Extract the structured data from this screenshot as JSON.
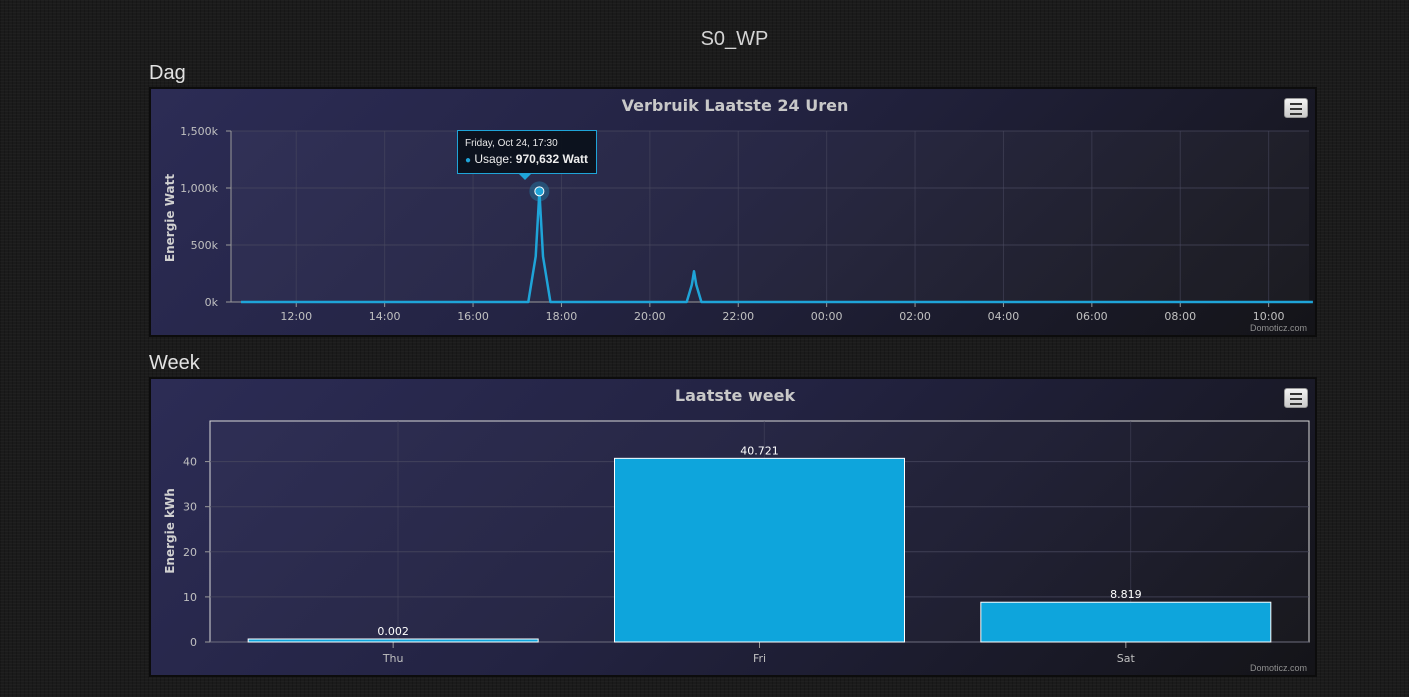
{
  "page": {
    "title": "S0_WP",
    "partial_text": ""
  },
  "sections": [
    {
      "heading": "Dag"
    },
    {
      "heading": "Week"
    }
  ],
  "colors": {
    "series": "#1fa4d8",
    "bar_fill": "#0ea5dc",
    "grid": "#4a4a60",
    "axis_text": "#c0c0c0",
    "title_text": "#c8c8c8"
  },
  "icons": {
    "menu": "hamburger-menu-icon"
  },
  "credits": "Domoticz.com",
  "tooltip": {
    "header": "Friday, Oct 24, 17:30",
    "series_label": "Usage:",
    "value": "970,632 Watt"
  },
  "chart_data": [
    {
      "type": "line",
      "title": "Verbruik Laatste 24 Uren",
      "ylabel": "Energie Watt",
      "xlabel": "",
      "ylim": [
        0,
        1500000
      ],
      "yticks": [
        "0k",
        "500k",
        "1,000k",
        "1,500k"
      ],
      "ytick_values": [
        0,
        500000,
        1000000,
        1500000
      ],
      "xticks": [
        "12:00",
        "14:00",
        "16:00",
        "18:00",
        "20:00",
        "22:00",
        "00:00",
        "02:00",
        "04:00",
        "06:00",
        "08:00",
        "10:00"
      ],
      "grid": true,
      "legend": "none",
      "series": [
        {
          "x": [
            "10:45",
            "17:15",
            "17:25",
            "17:30",
            "17:35",
            "17:45",
            "20:50",
            "20:57",
            "21:00",
            "21:03",
            "21:10",
            "11:00"
          ],
          "values": [
            0,
            0,
            400000,
            970632,
            400000,
            0,
            0,
            150000,
            270000,
            150000,
            0,
            0
          ]
        }
      ],
      "highlight": {
        "x": "17:30",
        "value": 970632
      }
    },
    {
      "type": "bar",
      "title": "Laatste week",
      "ylabel": "Energie kWh",
      "xlabel": "",
      "ylim": [
        0,
        49
      ],
      "yticks": [
        "0",
        "10",
        "20",
        "30",
        "40"
      ],
      "ytick_values": [
        0,
        10,
        20,
        30,
        40
      ],
      "categories": [
        "Thu",
        "Fri",
        "Sat"
      ],
      "values": [
        0.002,
        40.721,
        8.819
      ],
      "value_labels": [
        "0.002",
        "40.721",
        "8.819"
      ],
      "grid": true,
      "legend": "none"
    }
  ]
}
